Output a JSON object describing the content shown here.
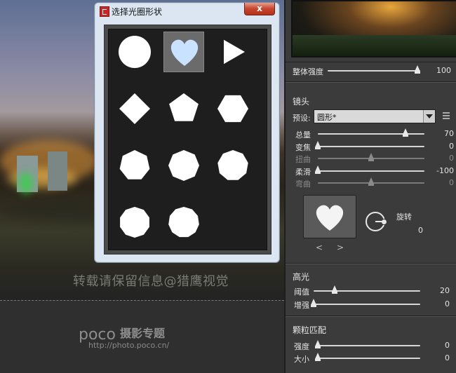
{
  "dialog": {
    "title": "选择光圈形状",
    "close_label": "x",
    "shapes": [
      "circle",
      "heart",
      "triangle",
      "diamond",
      "pentagon",
      "hexagon",
      "heptagon",
      "octagon",
      "nonagon",
      "decagon",
      "hendecagon"
    ],
    "selected": "heart"
  },
  "watermark": "转载请保留信息@猎鹰视觉",
  "logo": {
    "brand": "poco",
    "subtitle": "摄影专题",
    "url": "http://photo.poco.cn/"
  },
  "panel": {
    "overall": {
      "label": "整体强度",
      "value": "100",
      "level": 1.0
    },
    "lens": {
      "title": "镜头",
      "preset_label": "预设:",
      "preset_value": "圆形*",
      "sliders": [
        {
          "label": "总量",
          "value": "70",
          "level": 0.82,
          "dim": false
        },
        {
          "label": "变焦",
          "value": "0",
          "level": 0.0,
          "dim": false
        },
        {
          "label": "扭曲",
          "value": "0",
          "level": 0.5,
          "dim": true
        },
        {
          "label": "柔滑",
          "value": "-100",
          "level": 0.0,
          "dim": false
        },
        {
          "label": "弯曲",
          "value": "0",
          "level": 0.5,
          "dim": true
        }
      ],
      "rotate_label": "旋转",
      "rotate_value": "0",
      "prev": "<",
      "next": ">"
    },
    "highlights": {
      "title": "高光",
      "sliders": [
        {
          "label": "阈值",
          "value": "20",
          "level": 0.2
        },
        {
          "label": "增强",
          "value": "0",
          "level": 0.0
        }
      ]
    },
    "grain": {
      "title": "颗粒匹配",
      "sliders": [
        {
          "label": "强度",
          "value": "0",
          "level": 0.0
        },
        {
          "label": "大小",
          "value": "0",
          "level": 0.0
        }
      ]
    }
  },
  "colors": {
    "panel_bg": "#3b3b3b",
    "dialog_bg": "#dbe6f2",
    "close_red": "#c7452b"
  }
}
